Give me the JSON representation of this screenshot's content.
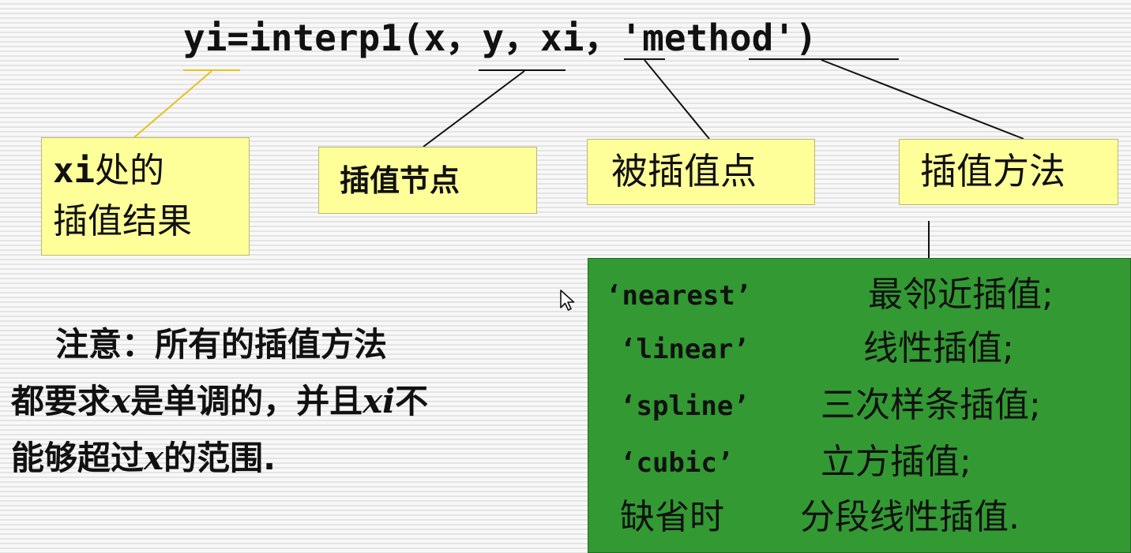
{
  "formula": {
    "yi": "yi",
    "eq_fn": "=interp1(",
    "x": "x",
    "sep1": "，",
    "y": "y",
    "sep2": "，",
    "xi": "xi",
    "sep3": "，",
    "method": "'method'",
    "close": ")"
  },
  "callouts": {
    "result_var": "xi",
    "result_line1_rest": "处的",
    "result_line2": "插值结果",
    "nodes": "插值节点",
    "points": "被插值点",
    "method": "插值方法"
  },
  "note": {
    "line1": "注意：所有的插值方法",
    "line2_a": "都要求",
    "line2_x": "x",
    "line2_b": "是单调的，并且",
    "line2_xi": "xi",
    "line2_c": "不",
    "line3_a": "能够超过",
    "line3_x": "x",
    "line3_b": "的范围."
  },
  "methods": [
    {
      "key": "‘nearest’",
      "desc": "最邻近插值;"
    },
    {
      "key": "‘linear’",
      "desc": "线性插值;"
    },
    {
      "key": "‘spline’",
      "desc": "三次样条插值;"
    },
    {
      "key": "‘cubic’",
      "desc": "立方插值;"
    },
    {
      "key": "缺省时",
      "desc": "分段线性插值."
    }
  ],
  "colors": {
    "callout_fill": "#ffff99",
    "methods_fill": "#339933",
    "result_connector": "#e8c11a",
    "connector": "#111111"
  }
}
